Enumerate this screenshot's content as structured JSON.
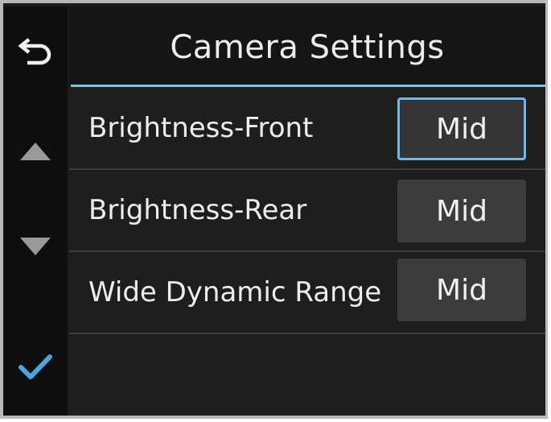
{
  "header": {
    "title": "Camera Settings"
  },
  "sidebar": {
    "back_icon": "back-arrow-icon",
    "up_icon": "triangle-up-icon",
    "down_icon": "triangle-down-icon",
    "confirm_icon": "checkmark-icon"
  },
  "settings": [
    {
      "label": "Brightness-Front",
      "value": "Mid",
      "selected": true
    },
    {
      "label": "Brightness-Rear",
      "value": "Mid",
      "selected": false
    },
    {
      "label": "Wide Dynamic Range",
      "value": "Mid",
      "selected": false
    }
  ],
  "colors": {
    "accent": "#6cb8e6",
    "background": "#1e1e1e",
    "sidebar": "#0f0f0f",
    "value_box": "#3c3c3c",
    "checkmark": "#4aa6de"
  }
}
